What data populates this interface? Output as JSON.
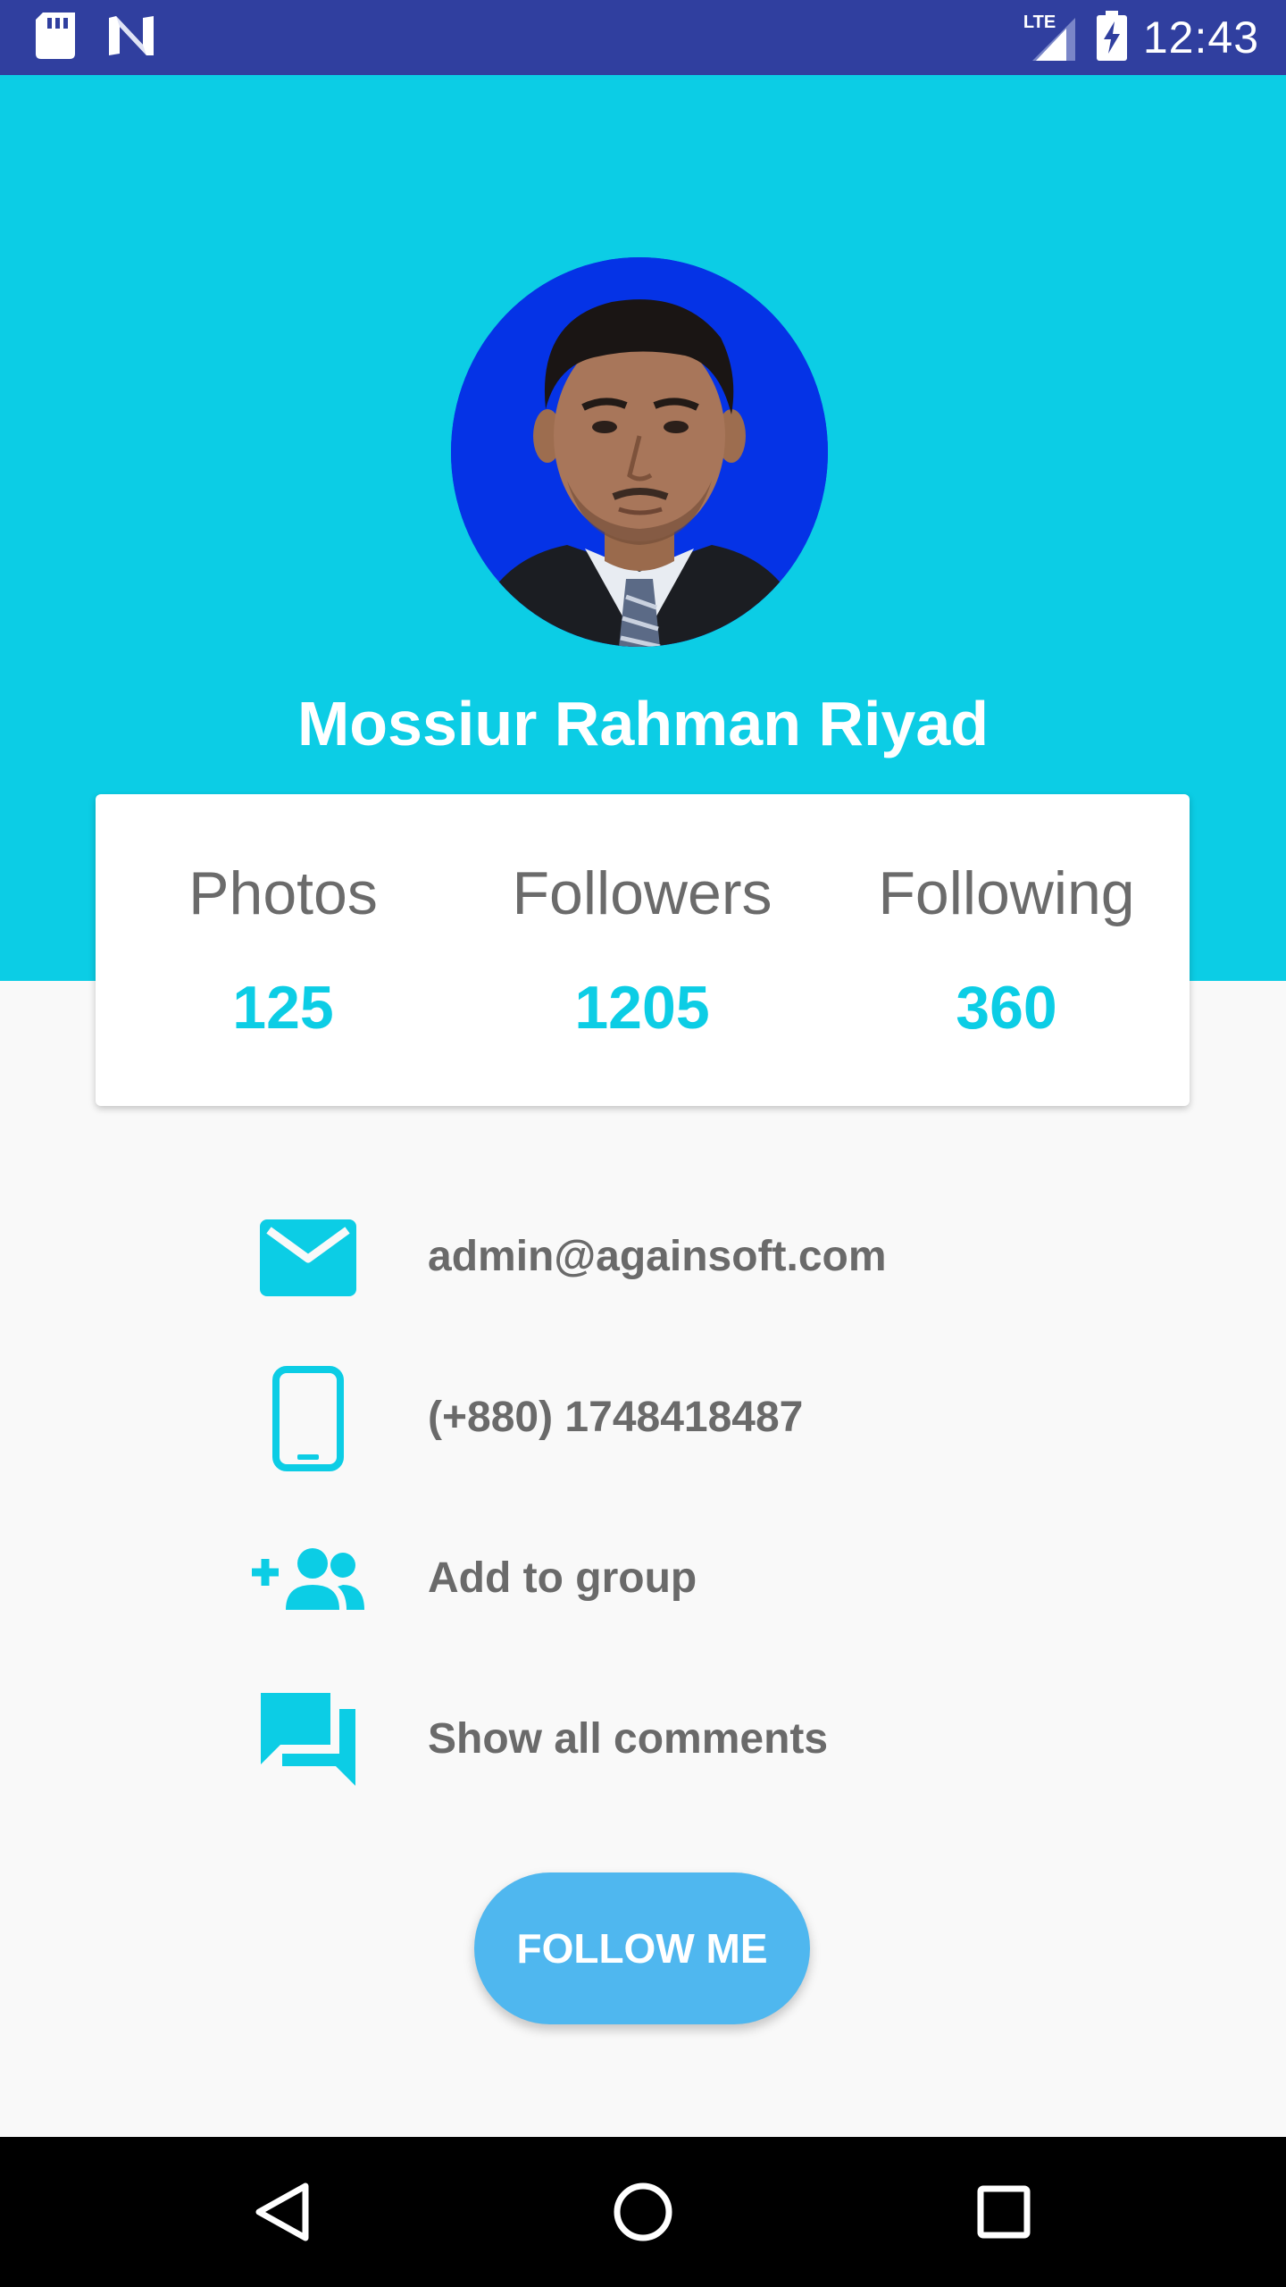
{
  "status_bar": {
    "time": "12:43",
    "network_label": "LTE",
    "icons": [
      "sd-card-icon",
      "n-logo-icon",
      "lte-signal-icon",
      "battery-charging-icon"
    ]
  },
  "profile": {
    "name": "Mossiur Rahman Riyad",
    "avatar_bg_color": "#0533e6"
  },
  "stats": [
    {
      "label": "Photos",
      "value": "125"
    },
    {
      "label": "Followers",
      "value": "1205"
    },
    {
      "label": "Following",
      "value": "360"
    }
  ],
  "info": {
    "email": "admin@againsoft.com",
    "phone": "(+880) 1748418487",
    "add_group": "Add to group",
    "comments": "Show all comments"
  },
  "follow_button": {
    "label": "FOLLOW ME"
  },
  "nav": [
    "back-icon",
    "home-icon",
    "recents-icon"
  ],
  "colors": {
    "status_bar": "#303f9f",
    "header": "#0ccde5",
    "accent": "#0ccde5",
    "button": "#4fb7ef",
    "background": "#f9f9f9"
  }
}
